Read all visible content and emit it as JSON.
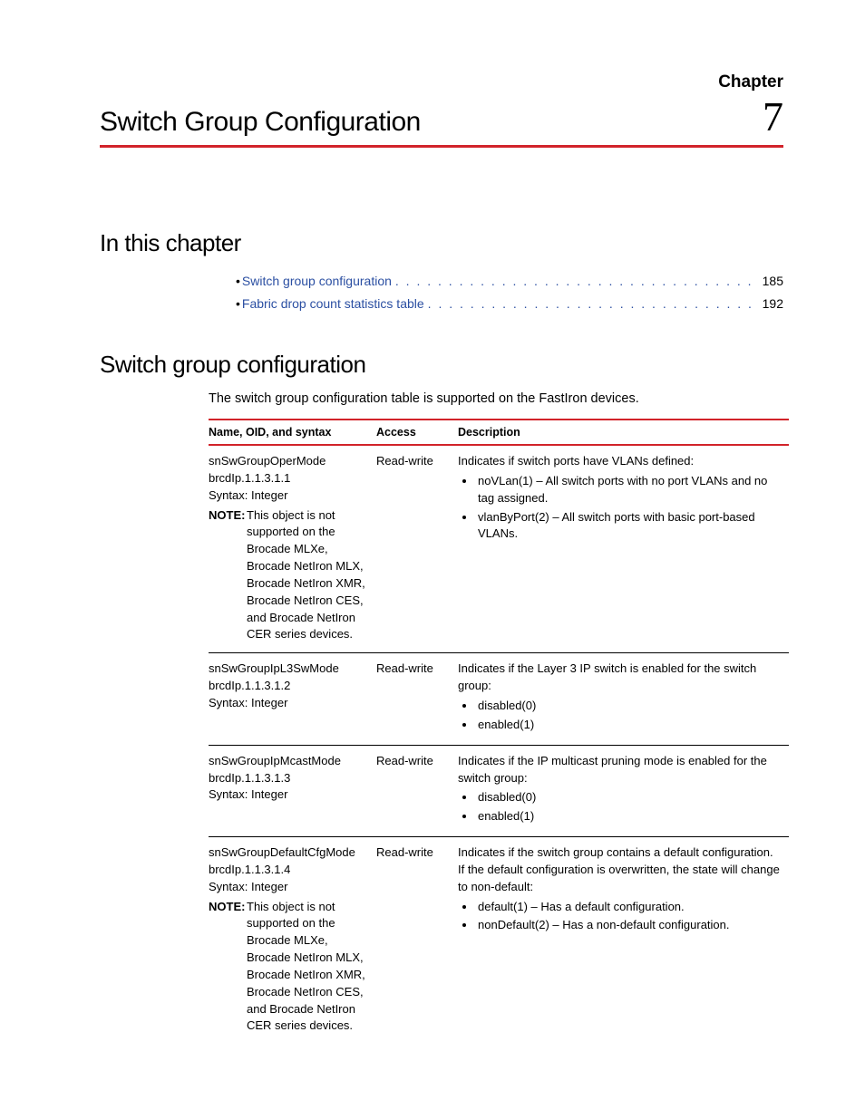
{
  "chapter": {
    "label": "Chapter",
    "number": "7",
    "title": "Switch Group Configuration"
  },
  "sections": {
    "in_this_chapter": "In this chapter",
    "switch_group_configuration": "Switch group configuration"
  },
  "toc": [
    {
      "label": "Switch group configuration",
      "dots": ". . . . . . . . . . . . . . . . . . . . . . . . . . . . . . . . . . . . . . .",
      "page": "185"
    },
    {
      "label": "Fabric drop count statistics table",
      "dots": ". . . . . . . . . . . . . . . . . . . . . . . . . . . . . . . . . .",
      "page": "192"
    }
  ],
  "intro": "The switch group configuration table is supported on the FastIron devices.",
  "table": {
    "headers": {
      "c1": "Name, OID, and syntax",
      "c2": "Access",
      "c3": "Description"
    },
    "rows": [
      {
        "name": "snSwGroupOperMode",
        "oid": "brcdIp.1.1.3.1.1",
        "syntax": "Syntax: Integer",
        "note_label": "NOTE:",
        "note": "This object is not supported on the Brocade MLXe, Brocade NetIron MLX, Brocade NetIron XMR, Brocade NetIron CES, and Brocade NetIron CER series devices.",
        "access": "Read-write",
        "desc_lead": "Indicates if switch ports have VLANs defined:",
        "desc_items": [
          "noVLan(1) – All switch ports with no port VLANs and no tag assigned.",
          "vlanByPort(2) – All switch ports with basic port-based VLANs."
        ]
      },
      {
        "name": "snSwGroupIpL3SwMode",
        "oid": "brcdIp.1.1.3.1.2",
        "syntax": "Syntax: Integer",
        "note_label": "",
        "note": "",
        "access": "Read-write",
        "desc_lead": "Indicates if the Layer 3 IP switch is enabled for the switch group:",
        "desc_items": [
          "disabled(0)",
          "enabled(1)"
        ]
      },
      {
        "name": "snSwGroupIpMcastMode",
        "oid": "brcdIp.1.1.3.1.3",
        "syntax": "Syntax: Integer",
        "note_label": "",
        "note": "",
        "access": "Read-write",
        "desc_lead": "Indicates if the IP multicast pruning mode is enabled for the switch group:",
        "desc_items": [
          "disabled(0)",
          "enabled(1)"
        ]
      },
      {
        "name": "snSwGroupDefaultCfgMode",
        "oid": "brcdIp.1.1.3.1.4",
        "syntax": "Syntax: Integer",
        "note_label": "NOTE:",
        "note": "This object is not supported on the Brocade MLXe, Brocade NetIron MLX, Brocade NetIron XMR, Brocade NetIron CES, and Brocade NetIron CER series devices.",
        "access": "Read-write",
        "desc_lead": "Indicates if the switch group contains a default configuration. If the default configuration is overwritten, the state will change to non-default:",
        "desc_items": [
          "default(1) – Has a default configuration.",
          "nonDefault(2) – Has a non-default configuration."
        ]
      }
    ]
  }
}
